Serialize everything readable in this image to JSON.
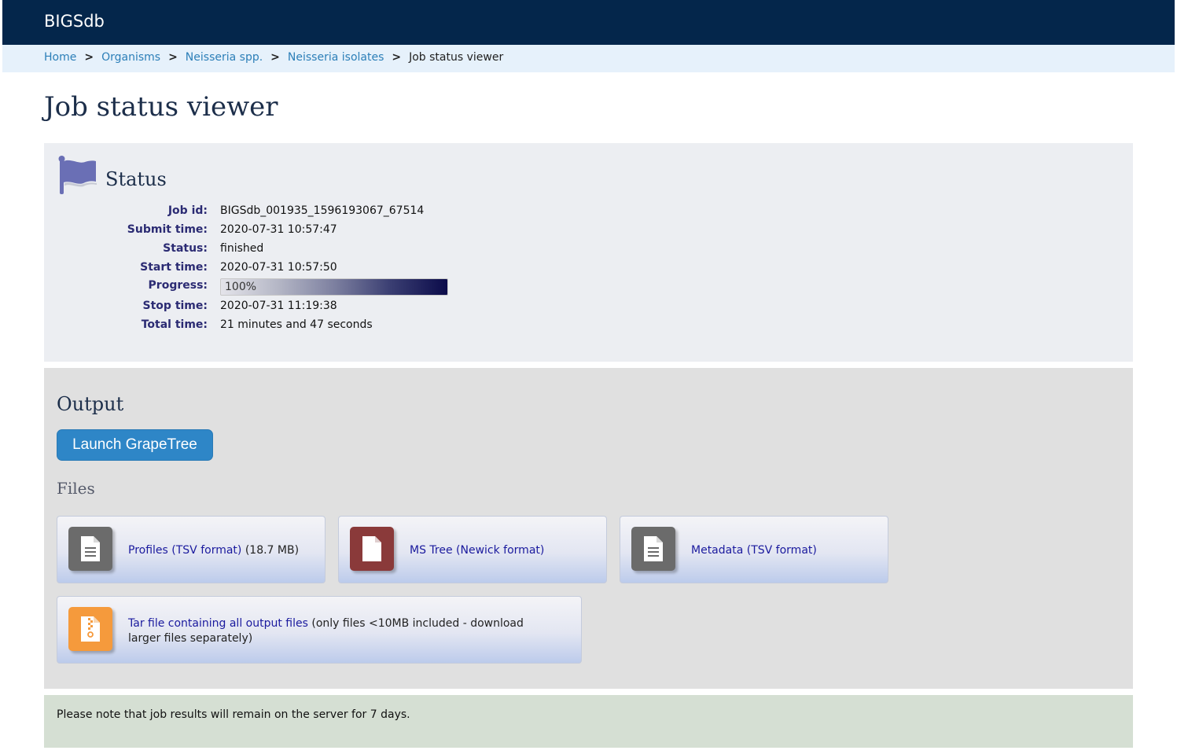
{
  "header": {
    "brand": "BIGSdb"
  },
  "breadcrumb": {
    "items": [
      "Home",
      "Organisms",
      "Neisseria spp.",
      "Neisseria isolates"
    ],
    "separator": ">",
    "current": "Job status viewer"
  },
  "page": {
    "title": "Job status viewer"
  },
  "status": {
    "title": "Status",
    "job_id_label": "Job id:",
    "job_id": "BIGSdb_001935_1596193067_67514",
    "submit_time_label": "Submit time:",
    "submit_time": "2020-07-31 10:57:47",
    "status_label": "Status:",
    "status": "finished",
    "start_time_label": "Start time:",
    "start_time": "2020-07-31 10:57:50",
    "progress_label": "Progress:",
    "progress": "100%",
    "progress_fraction": 1.0,
    "stop_time_label": "Stop time:",
    "stop_time": "2020-07-31 11:19:38",
    "total_time_label": "Total time:",
    "total_time": "21 minutes and 47 seconds"
  },
  "output": {
    "title": "Output",
    "launch_button": "Launch GrapeTree",
    "files_title": "Files",
    "files": [
      {
        "link": "Profiles (TSV format)",
        "extra": " (18.7 MB)",
        "icon": "file-text-icon",
        "color": "#6b6b6b"
      },
      {
        "link": "MS Tree (Newick format)",
        "extra": "",
        "icon": "file-icon",
        "color": "#8a3a3a"
      },
      {
        "link": "Metadata (TSV format)",
        "extra": "",
        "icon": "file-text-icon",
        "color": "#6b6b6b"
      },
      {
        "link": "Tar file containing all output files",
        "extra": " (only files <10MB included - download larger files separately)",
        "icon": "file-archive-icon",
        "color": "#f59a3c"
      }
    ]
  },
  "note": {
    "text": "Please note that job results will remain on the server for 7 days."
  },
  "colors": {
    "header_bg": "#04264b",
    "breadcrumb_bg": "#e6f1fb",
    "link": "#2c7fb8",
    "button": "#2e86c7",
    "flag": "#6a6fb5"
  }
}
